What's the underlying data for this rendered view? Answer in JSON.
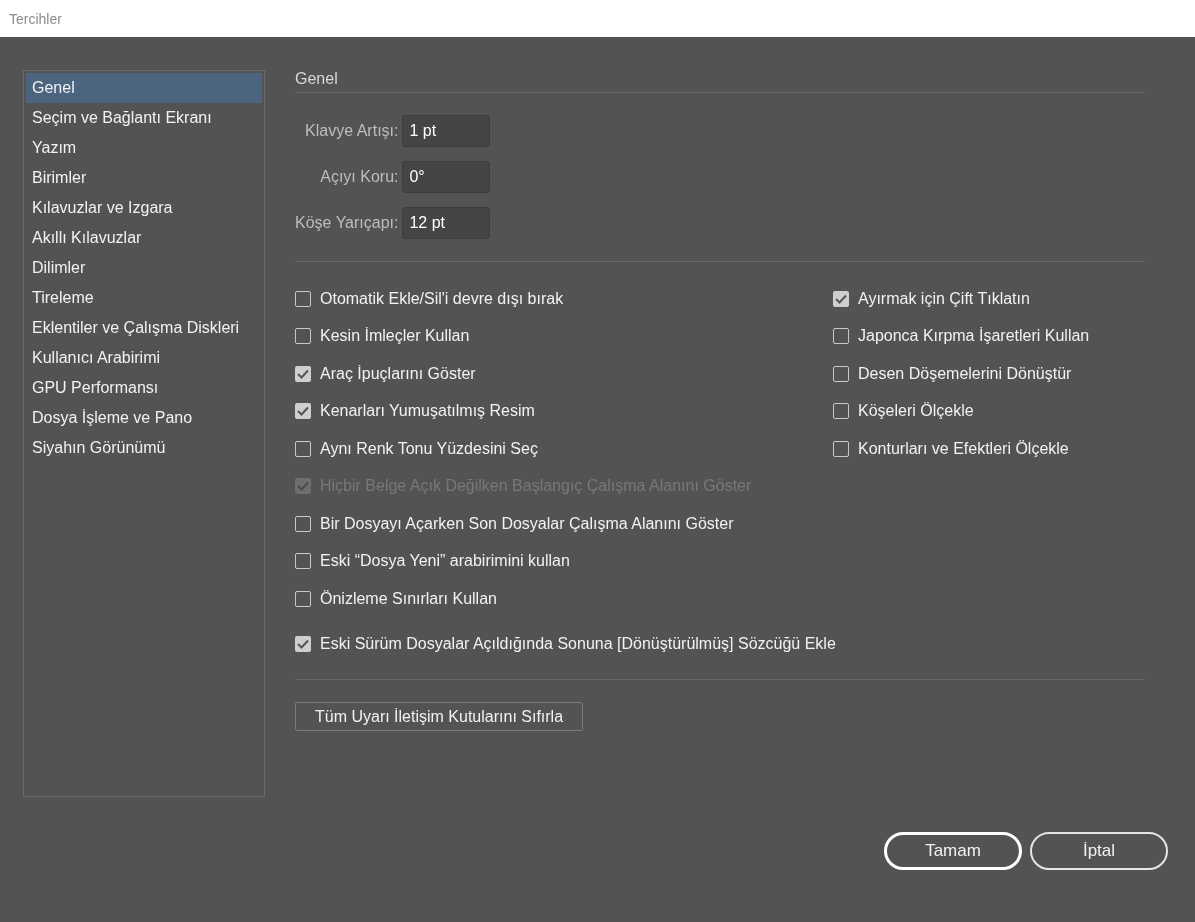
{
  "window": {
    "title": "Tercihler"
  },
  "sidebar": {
    "items": [
      {
        "label": "Genel",
        "selected": true
      },
      {
        "label": "Seçim ve Bağlantı Ekranı",
        "selected": false
      },
      {
        "label": "Yazım",
        "selected": false
      },
      {
        "label": "Birimler",
        "selected": false
      },
      {
        "label": "Kılavuzlar ve Izgara",
        "selected": false
      },
      {
        "label": "Akıllı Kılavuzlar",
        "selected": false
      },
      {
        "label": "Dilimler",
        "selected": false
      },
      {
        "label": "Tireleme",
        "selected": false
      },
      {
        "label": "Eklentiler ve Çalışma Diskleri",
        "selected": false
      },
      {
        "label": "Kullanıcı Arabirimi",
        "selected": false
      },
      {
        "label": "GPU Performansı",
        "selected": false
      },
      {
        "label": "Dosya İşleme ve Pano",
        "selected": false
      },
      {
        "label": "Siyahın Görünümü",
        "selected": false
      }
    ]
  },
  "section": {
    "title": "Genel"
  },
  "fields": [
    {
      "label": "Klavye Artışı:",
      "value": "1 pt"
    },
    {
      "label": "Açıyı Koru:",
      "value": "0°"
    },
    {
      "label": "Köşe Yarıçapı:",
      "value": "12 pt"
    }
  ],
  "options_left": [
    {
      "label": "Otomatik Ekle/Sil'i devre dışı bırak",
      "checked": false,
      "disabled": false
    },
    {
      "label": "Kesin İmleçler Kullan",
      "checked": false,
      "disabled": false
    },
    {
      "label": "Araç İpuçlarını Göster",
      "checked": true,
      "disabled": false
    },
    {
      "label": "Kenarları Yumuşatılmış Resim",
      "checked": true,
      "disabled": false
    },
    {
      "label": "Aynı Renk Tonu Yüzdesini Seç",
      "checked": false,
      "disabled": false
    }
  ],
  "options_right": [
    {
      "label": "Ayırmak için Çift Tıklatın",
      "checked": true,
      "disabled": false
    },
    {
      "label": "Japonca Kırpma İşaretleri Kullan",
      "checked": false,
      "disabled": false
    },
    {
      "label": "Desen Döşemelerini Dönüştür",
      "checked": false,
      "disabled": false
    },
    {
      "label": "Köşeleri Ölçekle",
      "checked": false,
      "disabled": false
    },
    {
      "label": "Konturları ve Efektleri Ölçekle",
      "checked": false,
      "disabled": false
    }
  ],
  "options": [
    {
      "label": "Hiçbir Belge Açık Değilken Başlangıç Çalışma Alanını Göster",
      "checked": true,
      "disabled": true
    },
    {
      "label": "Bir Dosyayı Açarken Son Dosyalar Çalışma Alanını Göster",
      "checked": false,
      "disabled": false
    },
    {
      "label": "Eski “Dosya Yeni” arabirimini kullan",
      "checked": false,
      "disabled": false
    },
    {
      "label": "Önizleme Sınırları Kullan",
      "checked": false,
      "disabled": false
    }
  ],
  "extra_option": {
    "label": "Eski Sürüm Dosyalar Açıldığında Sonuna [Dönüştürülmüş] Sözcüğü Ekle",
    "checked": true,
    "disabled": false
  },
  "reset_button": {
    "label": "Tüm Uyarı İletişim Kutularını Sıfırla"
  },
  "buttons": [
    {
      "label": "Tamam",
      "default": true
    },
    {
      "label": "İptal",
      "default": false
    }
  ]
}
